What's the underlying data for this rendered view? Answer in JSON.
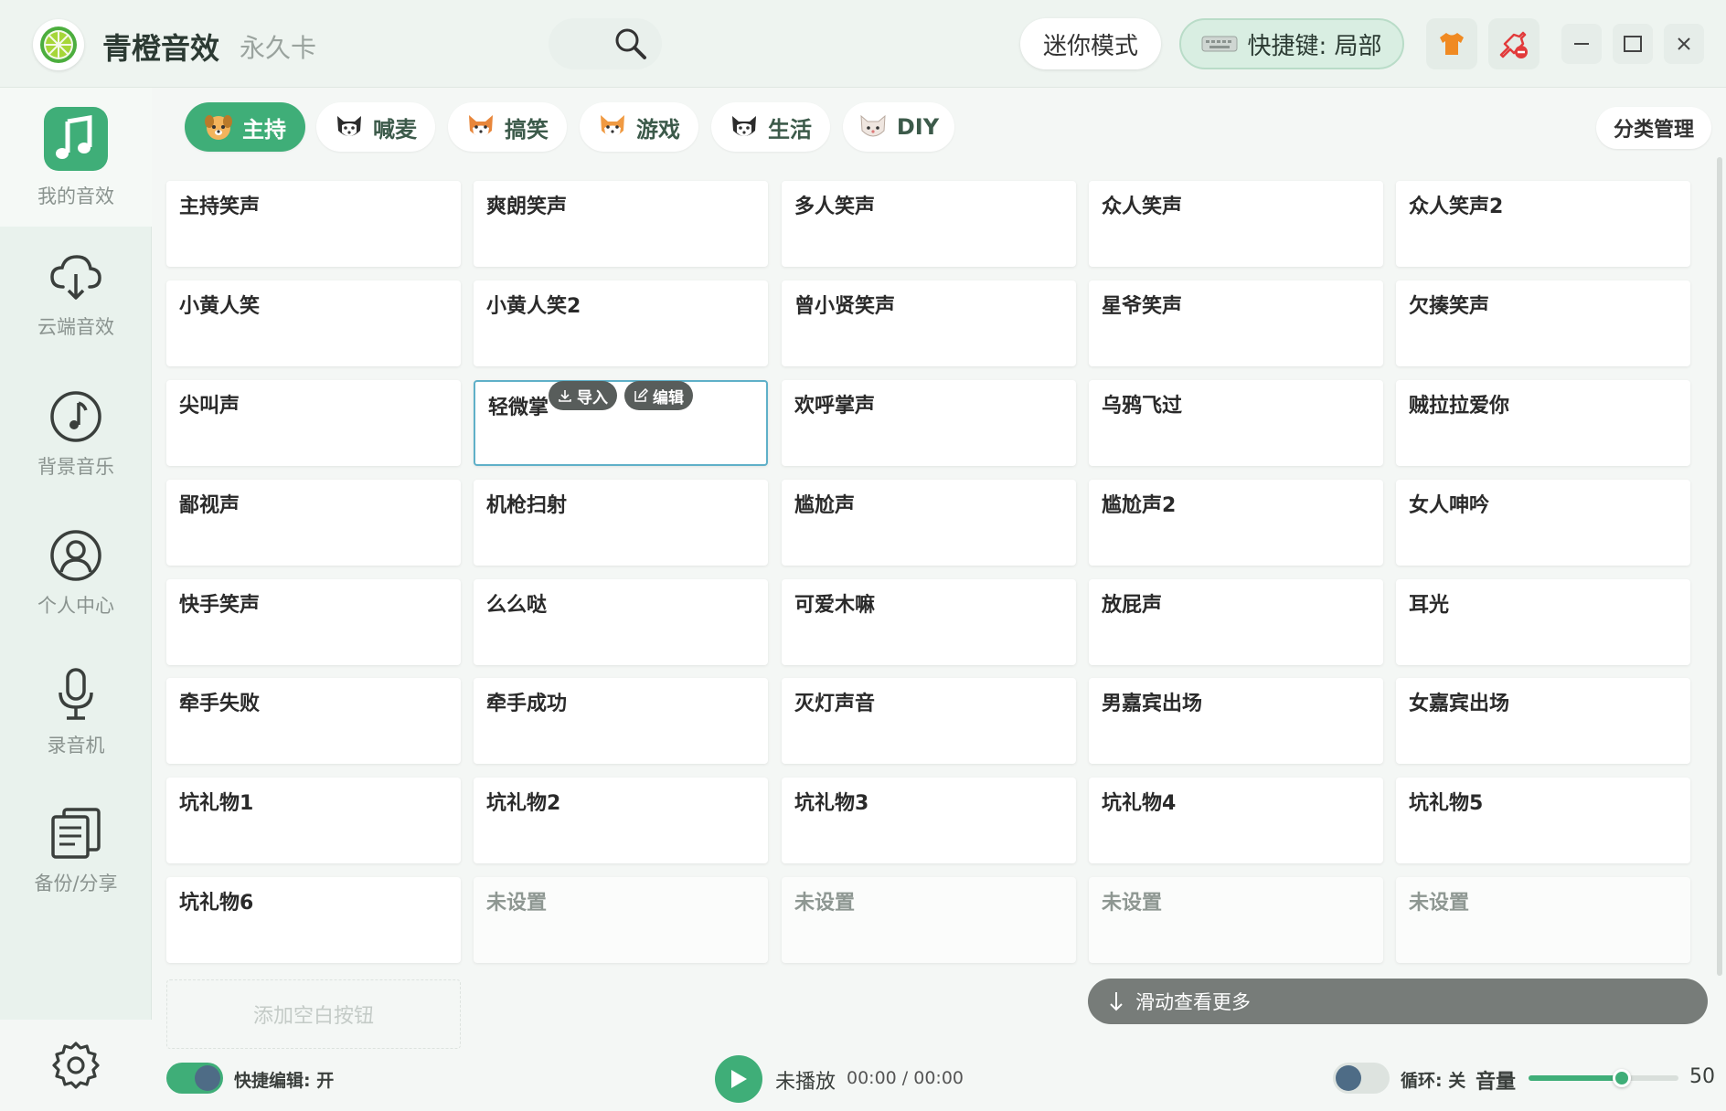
{
  "app": {
    "title": "青橙音效",
    "license": "永久卡"
  },
  "header": {
    "mini_mode": "迷你模式",
    "hotkey": "快捷键: 局部"
  },
  "sidebar": {
    "items": [
      {
        "label": "我的音效",
        "icon": "music-note-icon"
      },
      {
        "label": "云端音效",
        "icon": "cloud-download-icon"
      },
      {
        "label": "背景音乐",
        "icon": "music-disc-icon"
      },
      {
        "label": "个人中心",
        "icon": "user-icon"
      },
      {
        "label": "录音机",
        "icon": "microphone-icon"
      },
      {
        "label": "备份/分享",
        "icon": "document-icon"
      }
    ]
  },
  "tabs": [
    {
      "label": "主持"
    },
    {
      "label": "喊麦"
    },
    {
      "label": "搞笑"
    },
    {
      "label": "游戏"
    },
    {
      "label": "生活"
    },
    {
      "label": "DIY"
    }
  ],
  "category_manage": "分类管理",
  "sounds": [
    "主持笑声",
    "爽朗笑声",
    "多人笑声",
    "众人笑声",
    "众人笑声2",
    "小黄人笑",
    "小黄人笑2",
    "曾小贤笑声",
    "星爷笑声",
    "欠揍笑声",
    "尖叫声",
    "轻微掌",
    "欢呼掌声",
    "乌鸦飞过",
    "贼拉拉爱你",
    "鄙视声",
    "机枪扫射",
    "尴尬声",
    "尴尬声2",
    "女人呻吟",
    "快手笑声",
    "么么哒",
    "可爱木嘛",
    "放屁声",
    "耳光",
    "牵手失败",
    "牵手成功",
    "灭灯声音",
    "男嘉宾出场",
    "女嘉宾出场",
    "坑礼物1",
    "坑礼物2",
    "坑礼物3",
    "坑礼物4",
    "坑礼物5",
    "坑礼物6",
    "未设置",
    "未设置",
    "未设置",
    "未设置"
  ],
  "card_actions": {
    "import": "导入",
    "edit": "编辑"
  },
  "add_blank": "添加空白按钮",
  "scroll_more": "滑动查看更多",
  "footer": {
    "quick_edit": "快捷编辑: 开",
    "play_status": "未播放",
    "time": "00:00 / 00:00",
    "loop": "循环: 关",
    "volume_label": "音量",
    "volume": "50",
    "volume_fraction": 0.62
  },
  "colors": {
    "accent": "#3fae78",
    "selected_border": "#5fb0c8"
  }
}
